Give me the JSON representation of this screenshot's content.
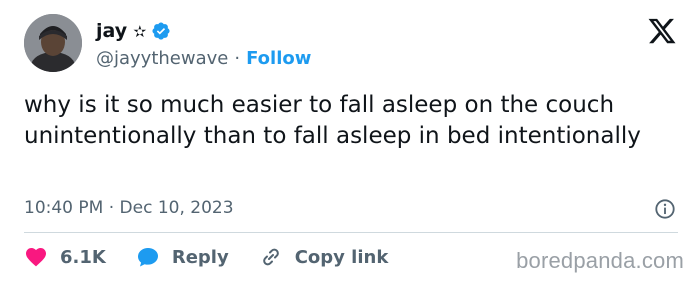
{
  "author": {
    "display_name": "jay",
    "badge_star": "✫",
    "handle": "@jayythewave",
    "separator": "·",
    "follow_label": "Follow"
  },
  "tweet": {
    "text": "why is it so much easier to fall asleep on the couch unintentionally than to fall asleep in bed intentionally",
    "timestamp": "10:40 PM · Dec 10, 2023"
  },
  "actions": {
    "likes": "6.1K",
    "reply_label": "Reply",
    "copy_link_label": "Copy link"
  },
  "watermark": "boredpanda.com",
  "colors": {
    "text": "#0f1419",
    "secondary": "#536471",
    "accent": "#1d9bf0",
    "heart": "#f91880",
    "divider": "#cfd9de"
  },
  "icons": [
    "x-logo-icon",
    "verified-icon",
    "info-icon",
    "heart-icon",
    "reply-icon",
    "link-icon"
  ]
}
